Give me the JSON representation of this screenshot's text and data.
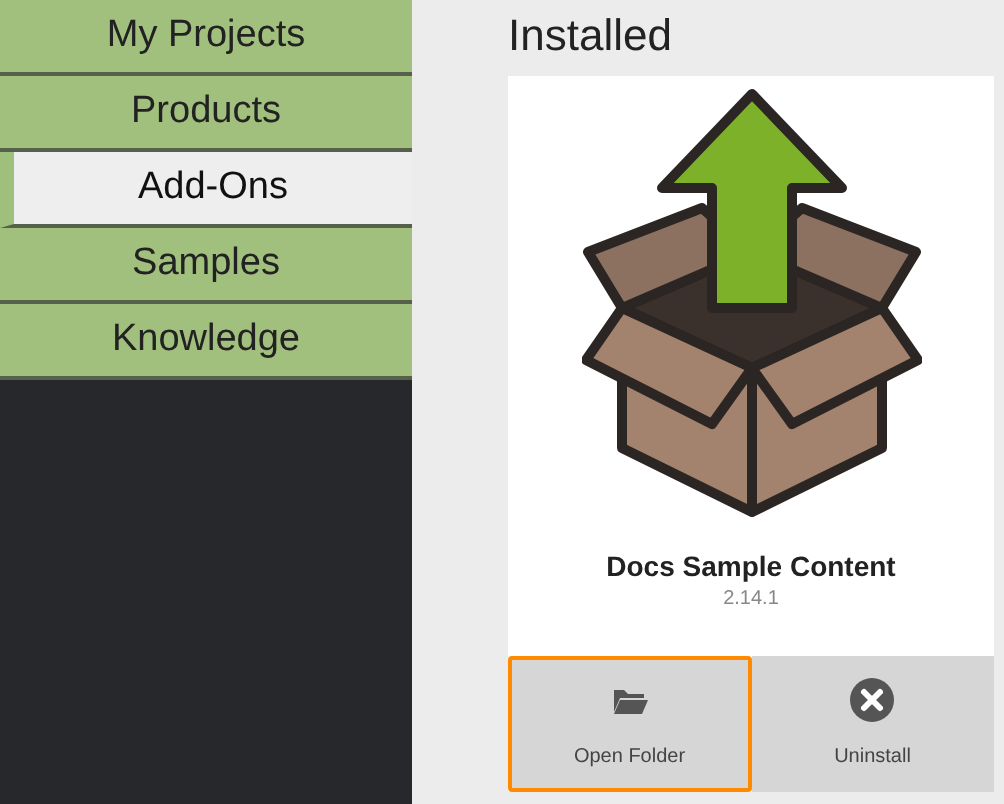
{
  "sidebar": {
    "items": [
      {
        "label": "My Projects",
        "selected": false
      },
      {
        "label": "Products",
        "selected": false
      },
      {
        "label": "Add-Ons",
        "selected": true
      },
      {
        "label": "Samples",
        "selected": false
      },
      {
        "label": "Knowledge",
        "selected": false
      }
    ]
  },
  "heading": "Installed",
  "card": {
    "title": "Docs Sample Content",
    "version": "2.14.1",
    "actions": [
      {
        "kind": "folder",
        "label": "Open Folder",
        "focused": true
      },
      {
        "kind": "uninstall",
        "label": "Uninstall",
        "focused": false
      }
    ]
  }
}
